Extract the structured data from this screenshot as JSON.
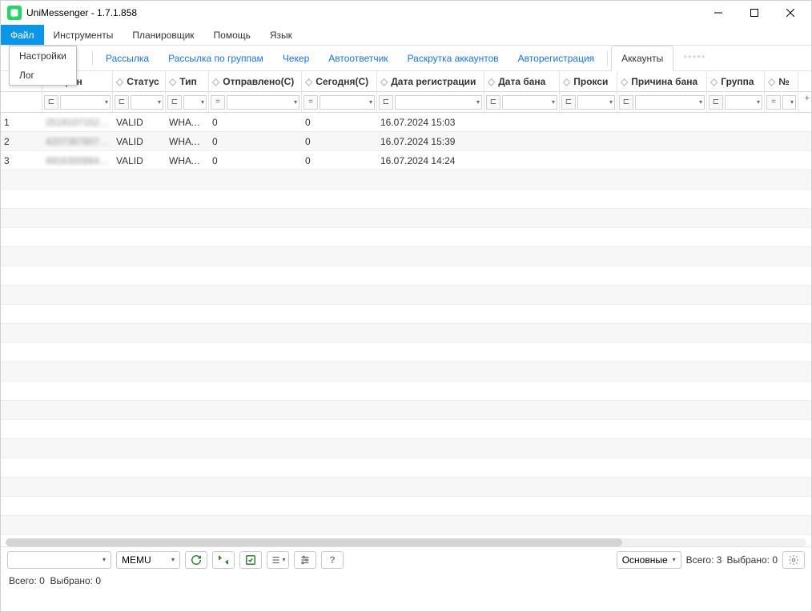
{
  "window": {
    "title": "UniMessenger - 1.7.1.858"
  },
  "menu": {
    "file": "Файл",
    "tools": "Инструменты",
    "scheduler": "Планировщик",
    "help": "Помощь",
    "language": "Язык"
  },
  "file_dropdown": {
    "settings": "Настройки",
    "log": "Лог"
  },
  "tabs": {
    "mailing": "Рассылка",
    "mailing_groups": "Рассылка по группам",
    "checker": "Чекер",
    "autoresponder": "Автоответчик",
    "boost": "Раскрутка аккаунтов",
    "autoreg": "Авторегистрация",
    "accounts": "Аккаунты",
    "more": "*****"
  },
  "grid": {
    "columns": {
      "phone": "елефон",
      "status": "Статус",
      "type": "Тип",
      "sent": "Отправлено(С)",
      "today": "Сегодня(С)",
      "reg_date": "Дата регистрации",
      "ban_date": "Дата бана",
      "proxy": "Прокси",
      "ban_reason": "Причина бана",
      "group": "Группа",
      "n": "№"
    },
    "filter_ops": {
      "contains": "⊏",
      "equals": "="
    },
    "rows": [
      {
        "idx": "1",
        "phone": "251910715296",
        "status": "VALID",
        "type": "WHATS...",
        "sent": "0",
        "today": "0",
        "reg_date": "16.07.2024 15:03",
        "ban_date": "",
        "proxy": "",
        "ban_reason": "",
        "group": ""
      },
      {
        "idx": "2",
        "phone": "420736780791",
        "status": "VALID",
        "type": "WHATS...",
        "sent": "0",
        "today": "0",
        "reg_date": "16.07.2024 15:39",
        "ban_date": "",
        "proxy": "",
        "ban_reason": "",
        "group": ""
      },
      {
        "idx": "3",
        "phone": "491630088436",
        "status": "VALID",
        "type": "WHATS...",
        "sent": "0",
        "today": "0",
        "reg_date": "16.07.2024 14:24",
        "ban_date": "",
        "proxy": "",
        "ban_reason": "",
        "group": ""
      }
    ]
  },
  "bottom": {
    "emulator": "MEMU",
    "filter_combo": "Основные",
    "total_label": "Всего:",
    "total_value": "3",
    "selected_label": "Выбрано:",
    "selected_value": "0"
  },
  "status": {
    "total_label": "Всего:",
    "total_value": "0",
    "selected_label": "Выбрано:",
    "selected_value": "0"
  }
}
